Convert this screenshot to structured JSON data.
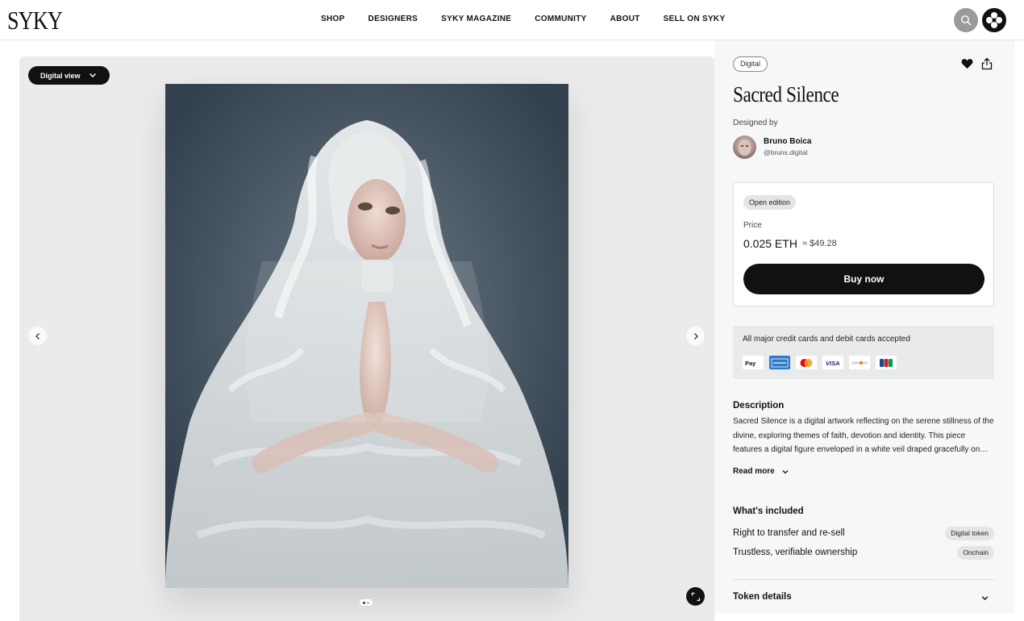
{
  "header": {
    "logo": "SYKY",
    "nav": [
      "SHOP",
      "DESIGNERS",
      "SYKY MAGAZINE",
      "COMMUNITY",
      "ABOUT",
      "SELL ON SYKY"
    ],
    "search_icon": "search-icon",
    "brand_icon": "syky-mark-icon"
  },
  "gallery": {
    "view_select": "Digital view",
    "image_count": 2,
    "current_image": 1
  },
  "product": {
    "tag": "Digital",
    "title": "Sacred Silence",
    "designed_by_label": "Designed by",
    "designer_name": "Bruno Boica",
    "designer_handle": "@bruns.digital",
    "edition": "Open edition",
    "price_label": "Price",
    "price_eth": "0.025 ETH",
    "price_usd": "≈ $49.28",
    "buy_label": "Buy now",
    "cards_text": "All major credit cards and debit cards accepted",
    "card_brands": [
      "Apple Pay",
      "American Express",
      "Mastercard",
      "Visa",
      "Discover",
      "JCB"
    ],
    "description_title": "Description",
    "description": "Sacred Silence is a digital artwork reflecting on the serene stillness of the divine, exploring themes of faith, devotion and identity. This piece features a digital figure enveloped in a white veil draped gracefully on…",
    "read_more": "Read more",
    "included_title": "What's included",
    "included": [
      {
        "text": "Right to transfer and re-sell",
        "badge": "Digital token"
      },
      {
        "text": "Trustless, verifiable ownership",
        "badge": "Onchain"
      }
    ],
    "token_details": "Token details"
  },
  "colors": {
    "accent": "#111111",
    "panel_bg": "#f6f7f9",
    "gallery_bg": "#ebebec"
  }
}
